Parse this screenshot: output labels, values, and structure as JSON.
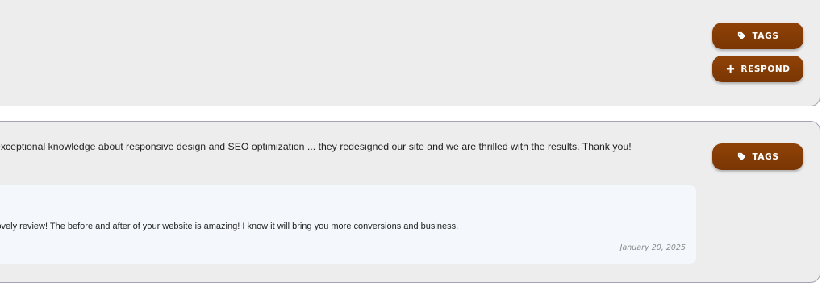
{
  "review_1": {
    "tags_label": "TAGS",
    "respond_label": "RESPOND"
  },
  "review_2": {
    "text": "exceptional knowledge about responsive design and SEO optimization ... they redesigned our site and we are thrilled with the results. Thank you!",
    "tags_label": "TAGS",
    "response": {
      "text": "lovely review! The before and after of your website is amazing! I know it will bring you more conversions and business.",
      "date": "January 20, 2025"
    }
  },
  "icons": {
    "tag": "tag-icon",
    "plus": "plus-icon"
  },
  "colors": {
    "button_bg": "#8a3f05",
    "card_bg": "#ededed",
    "card_border": "#a2a3b5",
    "response_bg": "#f4f8fc"
  }
}
